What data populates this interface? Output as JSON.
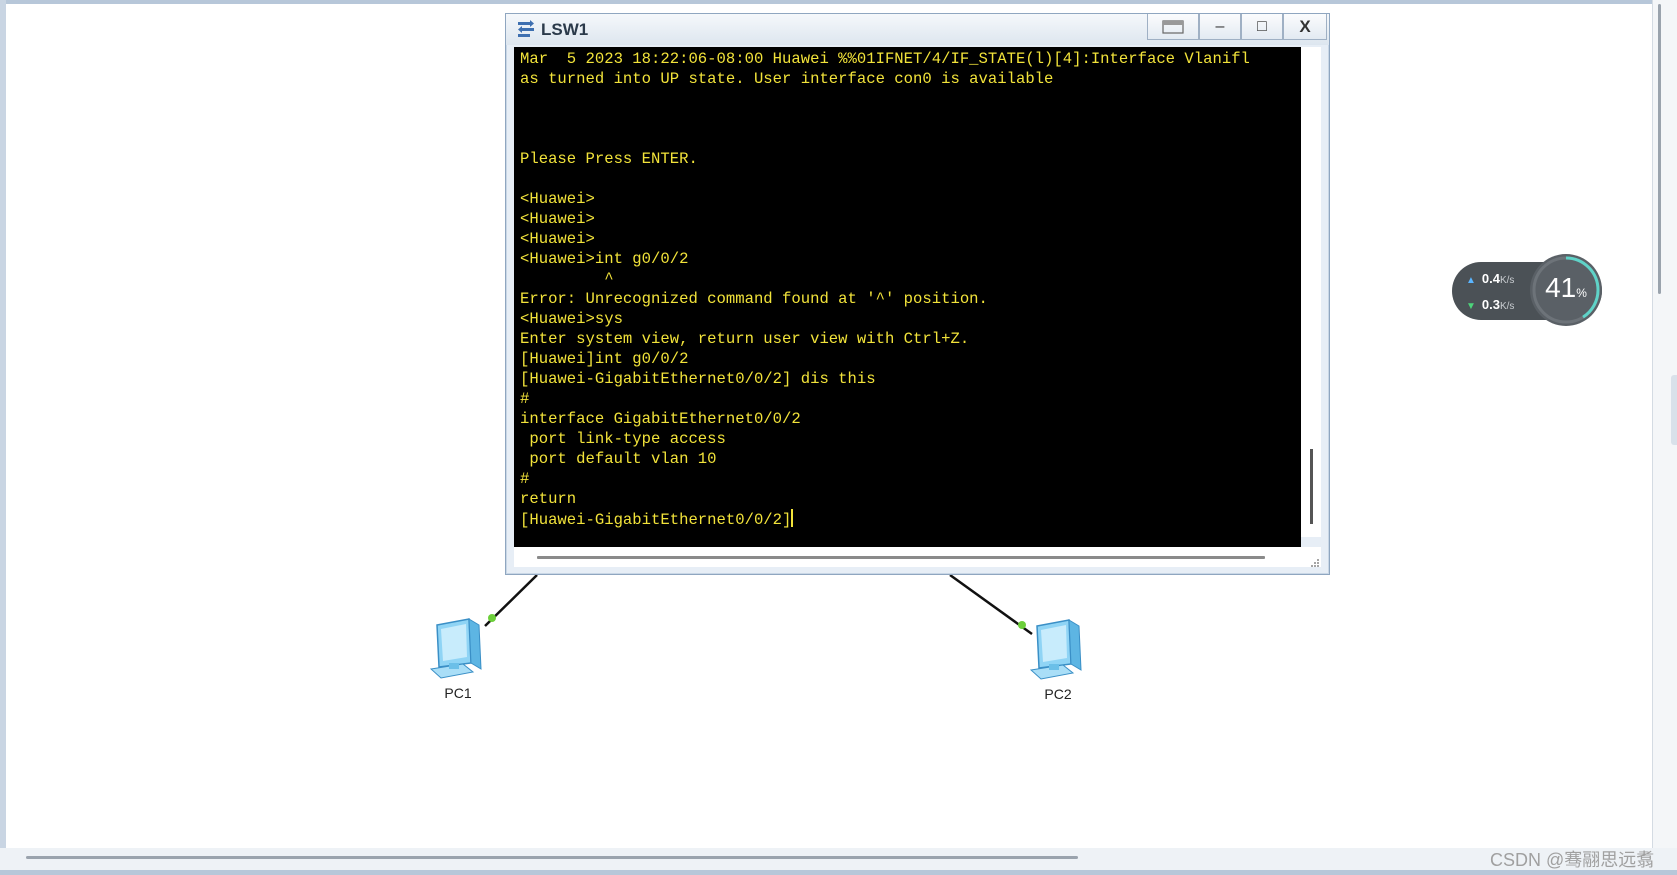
{
  "window": {
    "title": "LSW1",
    "buttons": {
      "minimize": "–",
      "maximize": "□",
      "close": "X"
    }
  },
  "terminal": {
    "lines": [
      "Mar  5 2023 18:22:06-08:00 Huawei %%01IFNET/4/IF_STATE(l)[4]:Interface Vlanifl",
      "as turned into UP state. User interface con0 is available",
      "",
      "",
      "",
      "Please Press ENTER.",
      "",
      "<Huawei>",
      "<Huawei>",
      "<Huawei>",
      "<Huawei>int g0/0/2",
      "         ^",
      "Error: Unrecognized command found at '^' position.",
      "<Huawei>sys",
      "Enter system view, return user view with Ctrl+Z.",
      "[Huawei]int g0/0/2",
      "[Huawei-GigabitEthernet0/0/2] dis this",
      "#",
      "interface GigabitEthernet0/0/2",
      " port link-type access",
      " port default vlan 10",
      "#",
      "return",
      "[Huawei-GigabitEthernet0/0/2]"
    ]
  },
  "topology": {
    "devices": [
      {
        "label": "PC1"
      },
      {
        "label": "PC2"
      }
    ],
    "link_color": "#111111",
    "port_dot_color": "#6ccf3a"
  },
  "network_monitor": {
    "upload": "0.4",
    "upload_unit": "K/s",
    "download": "0.3",
    "download_unit": "K/s",
    "usage": "41",
    "usage_unit": "%",
    "usage_fraction": 0.41
  },
  "watermark": "CSDN @骞翮思远翥"
}
